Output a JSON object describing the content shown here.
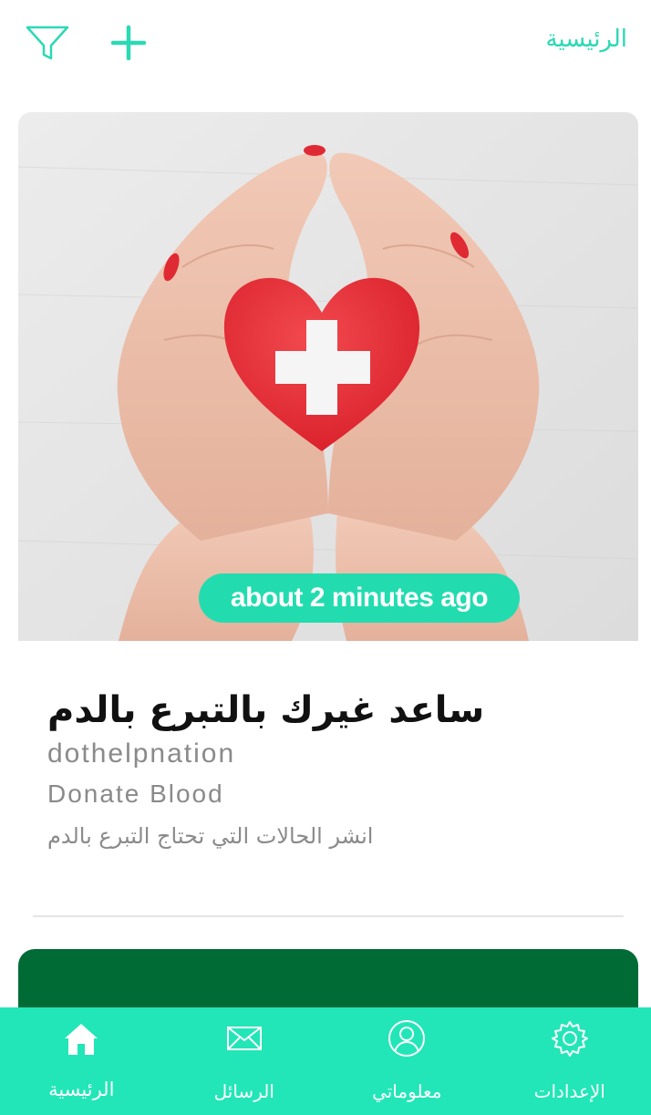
{
  "header": {
    "title": "الرئيسية",
    "filter_icon": "filter-icon",
    "add_icon": "plus-icon",
    "accent_color": "#2bd9b4"
  },
  "post": {
    "image_description_icon": "hands-holding-heart-icon",
    "time_ago": "about 2 minutes ago",
    "title": "ساعد غيرك بالتبرع بالدم",
    "username": "dothelpnation",
    "category": "Donate Blood",
    "description": "انشر الحالات التي تحتاج التبرع بالدم"
  },
  "bottom_nav": {
    "background": "#22e6b7",
    "items": [
      {
        "label": "الرئيسية",
        "icon": "home-icon",
        "active": true
      },
      {
        "label": "الرسائل",
        "icon": "mail-icon",
        "active": false
      },
      {
        "label": "معلوماتي",
        "icon": "profile-icon",
        "active": false
      },
      {
        "label": "الإعدادات",
        "icon": "gear-icon",
        "active": false
      }
    ]
  }
}
